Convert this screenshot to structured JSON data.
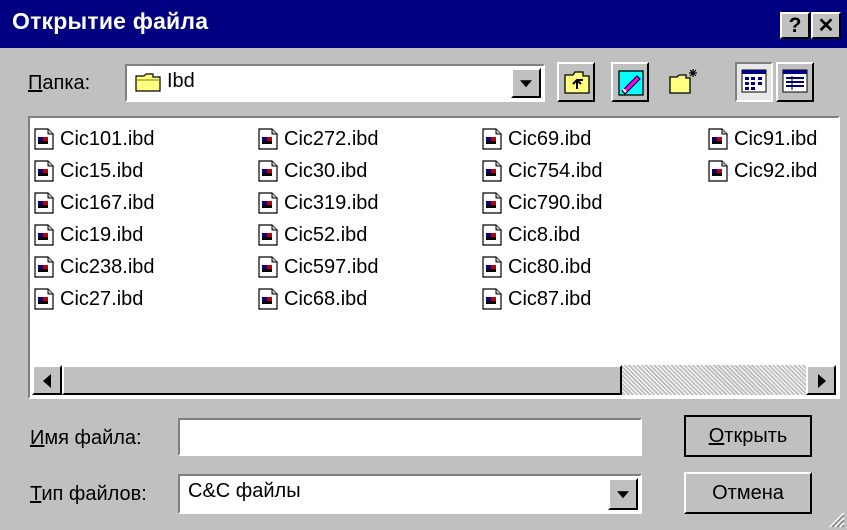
{
  "window": {
    "title": "Открытие файла",
    "help_label": "?",
    "close_label": "✕"
  },
  "folder": {
    "label_prefix": "П",
    "label_rest": "апка:",
    "value": "Ibd",
    "icon": "folder-icon"
  },
  "toolbar": {
    "buttons": [
      {
        "name": "up-one-level-icon"
      },
      {
        "name": "desktop-icon"
      },
      {
        "name": "new-folder-icon"
      },
      {
        "name": "list-view-icon"
      },
      {
        "name": "details-view-icon"
      }
    ]
  },
  "files": [
    [
      "Cic101.ibd",
      "Cic15.ibd",
      "Cic167.ibd",
      "Cic19.ibd",
      "Cic238.ibd",
      "Cic27.ibd"
    ],
    [
      "Cic272.ibd",
      "Cic30.ibd",
      "Cic319.ibd",
      "Cic52.ibd",
      "Cic597.ibd",
      "Cic68.ibd"
    ],
    [
      "Cic69.ibd",
      "Cic754.ibd",
      "Cic790.ibd",
      "Cic8.ibd",
      "Cic80.ibd",
      "Cic87.ibd"
    ],
    [
      "Cic91.ibd",
      "Cic92.ibd"
    ]
  ],
  "filename": {
    "label_prefix": "И",
    "label_rest": "мя файла:",
    "value": ""
  },
  "filetype": {
    "label_prefix": "Т",
    "label_rest": "ип файлов:",
    "value": "C&C файлы"
  },
  "buttons": {
    "open_prefix": "О",
    "open_rest": "ткрыть",
    "cancel": "Отмена"
  },
  "colors": {
    "titlebar": "#000080",
    "face": "#c0c0c0"
  }
}
